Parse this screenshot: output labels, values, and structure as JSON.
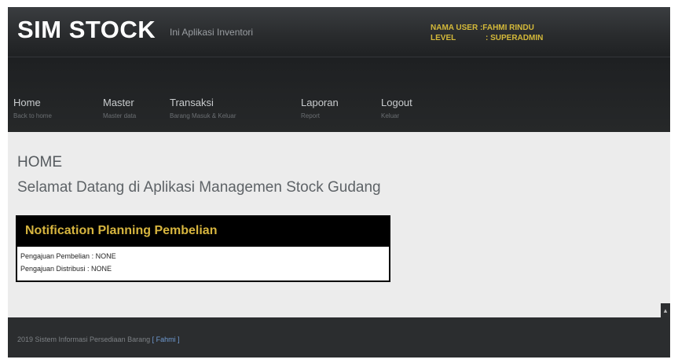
{
  "header": {
    "logo": "SIM STOCK",
    "subtitle": "Ini Aplikasi Inventori",
    "user_label": "NAMA USER : ",
    "user_value": "FAHMI RINDU",
    "level_label": "LEVEL",
    "level_value": ": SUPERADMIN"
  },
  "nav": {
    "items": [
      {
        "label": "Home",
        "sub": "Back to home"
      },
      {
        "label": "Master",
        "sub": "Master data"
      },
      {
        "label": "Transaksi",
        "sub": "Barang Masuk & Keluar"
      },
      {
        "label": "Laporan",
        "sub": "Report"
      },
      {
        "label": "Logout",
        "sub": "Keluar"
      }
    ]
  },
  "main": {
    "title": "HOME",
    "welcome": "Selamat Datang di Aplikasi Managemen Stock Gudang"
  },
  "notification": {
    "title": "Notification Planning Pembelian",
    "line1": "Pengajuan Pembelian : NONE",
    "line2": "Pengajuan Distribusi : NONE"
  },
  "footer": {
    "text": "2019 Sistem Informasi Persediaan Barang ",
    "link": "[ Fahmi ]"
  },
  "colors": {
    "accent": "#d7b53f",
    "header_bg": "#2a2c2e",
    "content_bg": "#ececec"
  },
  "icons": {
    "scroll_top": "chevron-up-icon"
  }
}
